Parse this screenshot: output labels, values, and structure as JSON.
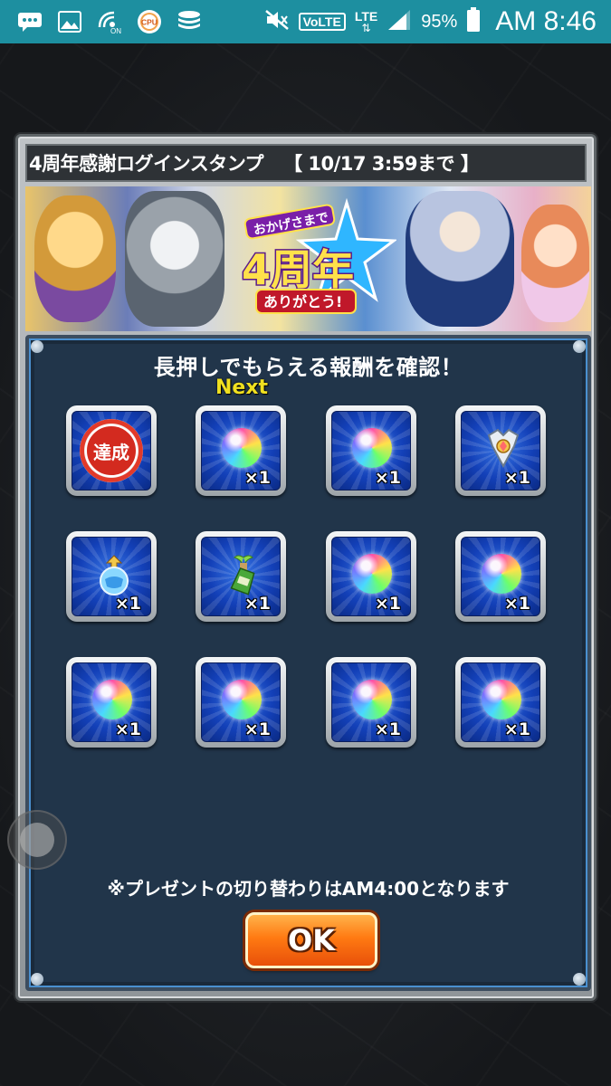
{
  "status_bar": {
    "left_icons": [
      "chat-bubble-icon",
      "image-icon",
      "wifi-calling-icon",
      "cpu-icon",
      "storage-icon"
    ],
    "cpu_label": "CPU",
    "wifi_on_label": "ON",
    "volte": "VoLTE",
    "lte": "LTE",
    "battery_percent": "95%",
    "time": "AM 8:46"
  },
  "dialog": {
    "title": "4周年感謝ログインスタンプ",
    "deadline": "【 10/17 3:59まで 】",
    "banner": {
      "logo_top": "おかげさまで",
      "logo_main": "4周年",
      "logo_bottom": "ありがとう!"
    },
    "heading": "長押しでもらえる報酬を確認！",
    "next_label": "Next",
    "rewards": [
      {
        "type": "stamp",
        "label": "達成"
      },
      {
        "type": "orb",
        "qty": "×1"
      },
      {
        "type": "orb",
        "qty": "×1"
      },
      {
        "type": "badge",
        "qty": "×1"
      },
      {
        "type": "potion",
        "qty": "×1"
      },
      {
        "type": "bottle",
        "qty": "×1"
      },
      {
        "type": "orb",
        "qty": "×1"
      },
      {
        "type": "orb",
        "qty": "×1"
      },
      {
        "type": "orb",
        "qty": "×1"
      },
      {
        "type": "orb",
        "qty": "×1"
      },
      {
        "type": "orb",
        "qty": "×1"
      },
      {
        "type": "orb",
        "qty": "×1"
      }
    ],
    "notice": "※プレゼントの切り替わりはAM4:00となります",
    "ok_label": "OK"
  }
}
